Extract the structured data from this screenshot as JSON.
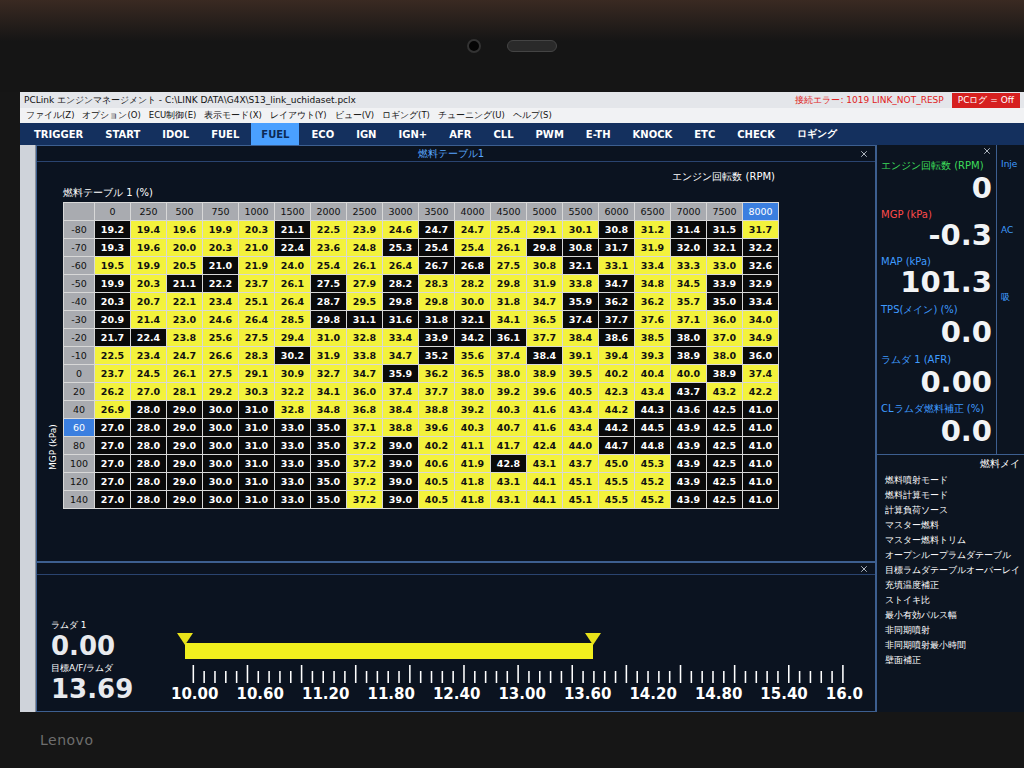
{
  "bezel": {
    "brand": "Lenovo"
  },
  "window": {
    "title": "PCLink エンジンマネージメント - C:\\LINK DATA\\G4X\\S13_link_uchidaset.pclx",
    "error": "接続エラー: 1019 LINK_NOT_RESP",
    "pc_log": "PCログ = Off"
  },
  "menu": [
    "ファイル(Z)",
    "オプション(O)",
    "ECU制御(E)",
    "表示モード(X)",
    "レイアウト(Y)",
    "ビュー(V)",
    "ロギング(T)",
    "チューニング(U)",
    "ヘルプ(S)"
  ],
  "tabs": [
    {
      "label": "TRIGGER",
      "selected": false
    },
    {
      "label": "START",
      "selected": false
    },
    {
      "label": "IDOL",
      "selected": false
    },
    {
      "label": "FUEL",
      "selected": false
    },
    {
      "label": "FUEL",
      "selected": true
    },
    {
      "label": "ECO",
      "selected": false
    },
    {
      "label": "IGN",
      "selected": false
    },
    {
      "label": "IGN+",
      "selected": false
    },
    {
      "label": "AFR",
      "selected": false
    },
    {
      "label": "CLL",
      "selected": false
    },
    {
      "label": "PWM",
      "selected": false
    },
    {
      "label": "E-TH",
      "selected": false
    },
    {
      "label": "KNOCK",
      "selected": false
    },
    {
      "label": "ETC",
      "selected": false
    },
    {
      "label": "CHECK",
      "selected": false
    },
    {
      "label": "ロギング",
      "selected": false
    }
  ],
  "table_panel": {
    "title": "燃料テーブル1",
    "x_axis": "エンジン回転数 (RPM)",
    "table_label": "燃料テーブル 1 (%)",
    "y_axis": "MGP (kPa)",
    "columns": [
      {
        "label": "0",
        "selected": false
      },
      {
        "label": "250",
        "selected": false
      },
      {
        "label": "500",
        "selected": false
      },
      {
        "label": "750",
        "selected": false
      },
      {
        "label": "1000",
        "selected": false
      },
      {
        "label": "1500",
        "selected": false
      },
      {
        "label": "2000",
        "selected": false
      },
      {
        "label": "2500",
        "selected": false
      },
      {
        "label": "3000",
        "selected": false
      },
      {
        "label": "3500",
        "selected": false
      },
      {
        "label": "4000",
        "selected": false
      },
      {
        "label": "4500",
        "selected": false
      },
      {
        "label": "5000",
        "selected": false
      },
      {
        "label": "5500",
        "selected": false
      },
      {
        "label": "6000",
        "selected": false
      },
      {
        "label": "6500",
        "selected": false
      },
      {
        "label": "7000",
        "selected": false
      },
      {
        "label": "7500",
        "selected": false
      },
      {
        "label": "8000",
        "selected": true
      }
    ],
    "rows": [
      {
        "label": "-80",
        "selected": false,
        "cells": [
          "19.2",
          "19.4",
          "19.6",
          "19.9",
          "20.3",
          "21.1",
          "22.5",
          "23.9",
          "24.6",
          "24.7",
          "24.7",
          "25.4",
          "29.1",
          "30.1",
          "30.8",
          "31.2",
          "31.4",
          "31.5",
          "31.7"
        ],
        "dark": [
          true,
          false,
          false,
          false,
          false,
          true,
          false,
          false,
          false,
          true,
          false,
          false,
          false,
          false,
          true,
          false,
          true,
          true,
          false
        ]
      },
      {
        "label": "-70",
        "selected": false,
        "cells": [
          "19.3",
          "19.6",
          "20.0",
          "20.3",
          "21.0",
          "22.4",
          "23.6",
          "24.8",
          "25.3",
          "25.4",
          "25.4",
          "26.1",
          "29.8",
          "30.8",
          "31.7",
          "31.9",
          "32.0",
          "32.1",
          "32.2"
        ],
        "dark": [
          true,
          false,
          false,
          false,
          false,
          true,
          false,
          false,
          true,
          true,
          false,
          false,
          true,
          true,
          true,
          false,
          true,
          true,
          true
        ]
      },
      {
        "label": "-60",
        "selected": false,
        "cells": [
          "19.5",
          "19.9",
          "20.5",
          "21.0",
          "21.9",
          "24.0",
          "25.4",
          "26.1",
          "26.4",
          "26.7",
          "26.8",
          "27.5",
          "30.8",
          "32.1",
          "33.1",
          "33.4",
          "33.3",
          "33.0",
          "32.6"
        ],
        "dark": [
          false,
          false,
          false,
          true,
          false,
          false,
          false,
          false,
          false,
          true,
          true,
          false,
          false,
          true,
          false,
          false,
          false,
          false,
          true
        ]
      },
      {
        "label": "-50",
        "selected": false,
        "cells": [
          "19.9",
          "20.3",
          "21.1",
          "22.2",
          "23.7",
          "26.1",
          "27.5",
          "27.9",
          "28.2",
          "28.3",
          "28.2",
          "29.8",
          "31.9",
          "33.8",
          "34.7",
          "34.8",
          "34.5",
          "33.9",
          "32.9"
        ],
        "dark": [
          true,
          false,
          true,
          true,
          false,
          false,
          true,
          false,
          true,
          false,
          false,
          false,
          false,
          false,
          true,
          false,
          false,
          true,
          true
        ]
      },
      {
        "label": "-40",
        "selected": false,
        "cells": [
          "20.3",
          "20.7",
          "22.1",
          "23.4",
          "25.1",
          "26.4",
          "28.7",
          "29.5",
          "29.8",
          "29.8",
          "30.0",
          "31.8",
          "34.7",
          "35.9",
          "36.2",
          "36.2",
          "35.7",
          "35.0",
          "33.4"
        ],
        "dark": [
          true,
          false,
          false,
          false,
          false,
          false,
          true,
          false,
          true,
          false,
          false,
          false,
          false,
          true,
          true,
          false,
          false,
          true,
          true
        ]
      },
      {
        "label": "-30",
        "selected": false,
        "cells": [
          "20.9",
          "21.4",
          "23.0",
          "24.6",
          "26.4",
          "28.5",
          "29.8",
          "31.1",
          "31.6",
          "31.8",
          "32.1",
          "34.1",
          "36.5",
          "37.4",
          "37.7",
          "37.6",
          "37.1",
          "36.0",
          "34.0"
        ],
        "dark": [
          true,
          false,
          false,
          false,
          false,
          false,
          true,
          true,
          true,
          true,
          true,
          false,
          false,
          true,
          true,
          false,
          false,
          false,
          false
        ]
      },
      {
        "label": "-20",
        "selected": false,
        "cells": [
          "21.7",
          "22.4",
          "23.8",
          "25.6",
          "27.5",
          "29.4",
          "31.0",
          "32.8",
          "33.4",
          "33.9",
          "34.2",
          "36.1",
          "37.7",
          "38.4",
          "38.6",
          "38.5",
          "38.0",
          "37.0",
          "34.9"
        ],
        "dark": [
          true,
          true,
          false,
          false,
          false,
          false,
          false,
          false,
          false,
          true,
          true,
          true,
          false,
          false,
          true,
          false,
          true,
          false,
          false
        ]
      },
      {
        "label": "-10",
        "selected": false,
        "cells": [
          "22.5",
          "23.4",
          "24.7",
          "26.6",
          "28.3",
          "30.2",
          "31.9",
          "33.8",
          "34.7",
          "35.2",
          "35.6",
          "37.4",
          "38.4",
          "39.1",
          "39.4",
          "39.3",
          "38.9",
          "38.0",
          "36.0"
        ],
        "dark": [
          false,
          false,
          false,
          false,
          false,
          true,
          false,
          false,
          false,
          true,
          false,
          false,
          true,
          false,
          false,
          false,
          true,
          false,
          true
        ]
      },
      {
        "label": "0",
        "selected": false,
        "cells": [
          "23.7",
          "24.5",
          "26.1",
          "27.5",
          "29.1",
          "30.9",
          "32.7",
          "34.7",
          "35.9",
          "36.2",
          "36.5",
          "38.0",
          "38.9",
          "39.5",
          "40.2",
          "40.4",
          "40.0",
          "38.9",
          "37.4"
        ],
        "dark": [
          false,
          false,
          false,
          false,
          false,
          false,
          false,
          false,
          true,
          false,
          false,
          false,
          false,
          false,
          false,
          false,
          false,
          true,
          false
        ]
      },
      {
        "label": "20",
        "selected": false,
        "cells": [
          "26.2",
          "27.0",
          "28.1",
          "29.2",
          "30.3",
          "32.2",
          "34.1",
          "36.0",
          "37.4",
          "37.7",
          "38.0",
          "39.2",
          "39.6",
          "40.5",
          "42.3",
          "43.4",
          "43.7",
          "43.2",
          "42.2"
        ],
        "dark": [
          false,
          false,
          false,
          false,
          false,
          false,
          false,
          false,
          false,
          false,
          false,
          false,
          false,
          false,
          false,
          false,
          true,
          false,
          false
        ]
      },
      {
        "label": "40",
        "selected": false,
        "cells": [
          "26.9",
          "28.0",
          "29.0",
          "30.0",
          "31.0",
          "32.8",
          "34.8",
          "36.8",
          "38.4",
          "38.8",
          "39.2",
          "40.3",
          "41.6",
          "43.4",
          "44.2",
          "44.3",
          "43.6",
          "42.5",
          "41.0"
        ],
        "dark": [
          false,
          true,
          true,
          true,
          true,
          false,
          false,
          false,
          false,
          false,
          false,
          false,
          false,
          false,
          false,
          true,
          true,
          true,
          true
        ]
      },
      {
        "label": "60",
        "selected": true,
        "cells": [
          "27.0",
          "28.0",
          "29.0",
          "30.0",
          "31.0",
          "33.0",
          "35.0",
          "37.1",
          "38.8",
          "39.6",
          "40.3",
          "40.7",
          "41.6",
          "43.4",
          "44.2",
          "44.5",
          "43.9",
          "42.5",
          "41.0"
        ],
        "dark": [
          true,
          true,
          true,
          true,
          true,
          true,
          true,
          false,
          false,
          false,
          false,
          false,
          false,
          false,
          true,
          true,
          true,
          true,
          true
        ]
      },
      {
        "label": "80",
        "selected": false,
        "cells": [
          "27.0",
          "28.0",
          "29.0",
          "30.0",
          "31.0",
          "33.0",
          "35.0",
          "37.2",
          "39.0",
          "40.2",
          "41.1",
          "41.7",
          "42.4",
          "44.0",
          "44.7",
          "44.8",
          "43.9",
          "42.5",
          "41.0"
        ],
        "dark": [
          true,
          true,
          true,
          true,
          true,
          true,
          true,
          false,
          true,
          false,
          false,
          false,
          false,
          false,
          true,
          true,
          true,
          true,
          true
        ]
      },
      {
        "label": "100",
        "selected": false,
        "cells": [
          "27.0",
          "28.0",
          "29.0",
          "30.0",
          "31.0",
          "33.0",
          "35.0",
          "37.2",
          "39.0",
          "40.6",
          "41.9",
          "42.8",
          "43.1",
          "43.7",
          "45.0",
          "45.3",
          "43.9",
          "42.5",
          "41.0"
        ],
        "dark": [
          true,
          true,
          true,
          true,
          true,
          true,
          true,
          false,
          true,
          false,
          false,
          true,
          false,
          false,
          false,
          false,
          true,
          true,
          true
        ]
      },
      {
        "label": "120",
        "selected": false,
        "cells": [
          "27.0",
          "28.0",
          "29.0",
          "30.0",
          "31.0",
          "33.0",
          "35.0",
          "37.2",
          "39.0",
          "40.5",
          "41.8",
          "43.1",
          "44.1",
          "45.1",
          "45.5",
          "45.2",
          "43.9",
          "42.5",
          "41.0"
        ],
        "dark": [
          true,
          true,
          true,
          true,
          true,
          true,
          true,
          false,
          true,
          false,
          false,
          false,
          false,
          false,
          false,
          false,
          true,
          true,
          true
        ]
      },
      {
        "label": "140",
        "selected": false,
        "cells": [
          "27.0",
          "28.0",
          "29.0",
          "30.0",
          "31.0",
          "33.0",
          "35.0",
          "37.2",
          "39.0",
          "40.5",
          "41.8",
          "43.1",
          "44.1",
          "45.1",
          "45.5",
          "45.2",
          "43.9",
          "42.5",
          "41.0"
        ],
        "dark": [
          true,
          true,
          true,
          true,
          true,
          true,
          true,
          false,
          true,
          false,
          false,
          false,
          false,
          false,
          false,
          false,
          true,
          true,
          true
        ]
      }
    ]
  },
  "lambda_panel": {
    "label": "ラムダ 1",
    "value": "0.00",
    "target_label": "目標A/F/ラムダ",
    "target_value": "13.69",
    "level": 0.615,
    "scale": [
      "10.00",
      "10.60",
      "11.20",
      "11.80",
      "12.40",
      "13.00",
      "13.60",
      "14.20",
      "14.80",
      "15.40",
      "16.0"
    ]
  },
  "gauges": [
    {
      "label": "エンジン回転数 (RPM)",
      "value": "0",
      "color": "#3ddc5a"
    },
    {
      "label": "MGP (kPa)",
      "value": "-0.3",
      "color": "#ff4a4a"
    },
    {
      "label": "MAP (kPa)",
      "value": "101.3",
      "color": "#3f9bff"
    },
    {
      "label": "TPS(メイン) (%)",
      "value": "0.0",
      "color": "#3f9bff"
    },
    {
      "label": "ラムダ 1 (AFR)",
      "value": "0.00",
      "color": "#3f9bff"
    },
    {
      "label": "CLラムダ燃料補正 (%)",
      "value": "0.0",
      "color": "#3f9bff"
    }
  ],
  "partial_gauges": [
    "Inje",
    "AC",
    "吸"
  ],
  "settings": {
    "title": "燃料メイ",
    "items": [
      "燃料噴射モード",
      "燃料計算モード",
      "計算負荷ソース",
      "マスター燃料",
      "マスター燃料トリム",
      "オープンループラムダテーブル",
      "目標ラムダテーブルオーバーレイ",
      "充填温度補正",
      "ストイキ比",
      "最小有効パルス幅",
      "非同期噴射",
      "非同期噴射最小時間",
      "壁面補正"
    ]
  }
}
